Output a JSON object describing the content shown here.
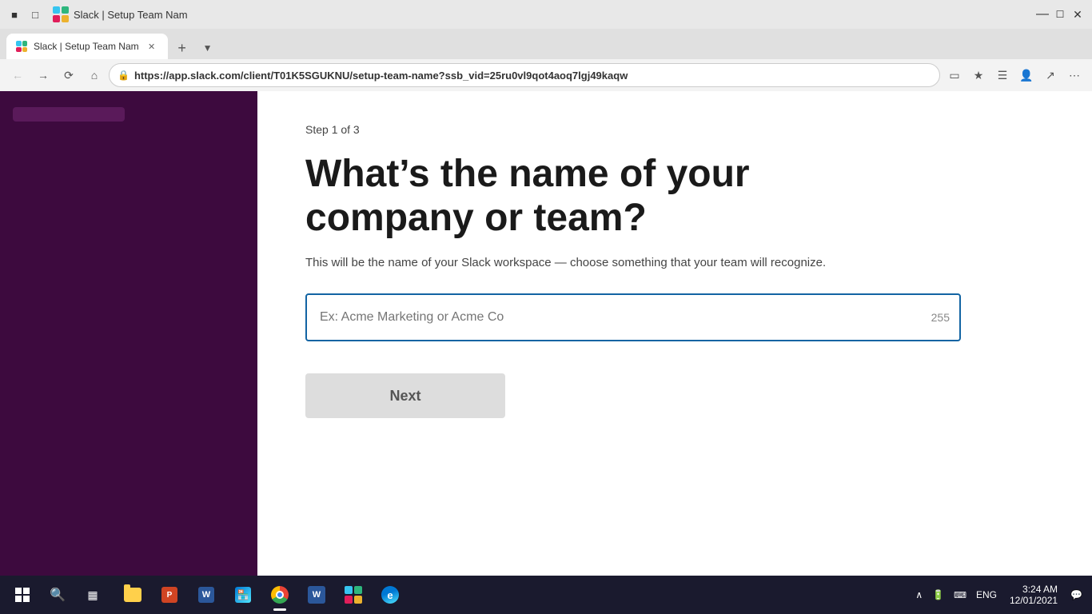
{
  "browser": {
    "title": "Slack | Setup Team Nam",
    "url_prefix": "https://",
    "url_bold": "app.slack.com",
    "url_path": "/client/T01K5SGUKNU/setup-team-name?ssb_vid=25ru0vl9qot4aoq7lgj49kaqw",
    "tab_title": "Slack | Setup Team Nam"
  },
  "page": {
    "step_label": "Step 1 of 3",
    "heading_line1": "What’s the name of your",
    "heading_line2": "company or team?",
    "sub_text": "This will be the name of your Slack workspace — choose something that your team will recognize.",
    "input_placeholder": "Ex: Acme Marketing or Acme Co",
    "char_count": "255",
    "next_button_label": "Next"
  },
  "taskbar": {
    "time": "3:24 AM",
    "date": "12/01/2021",
    "lang": "ENG"
  }
}
